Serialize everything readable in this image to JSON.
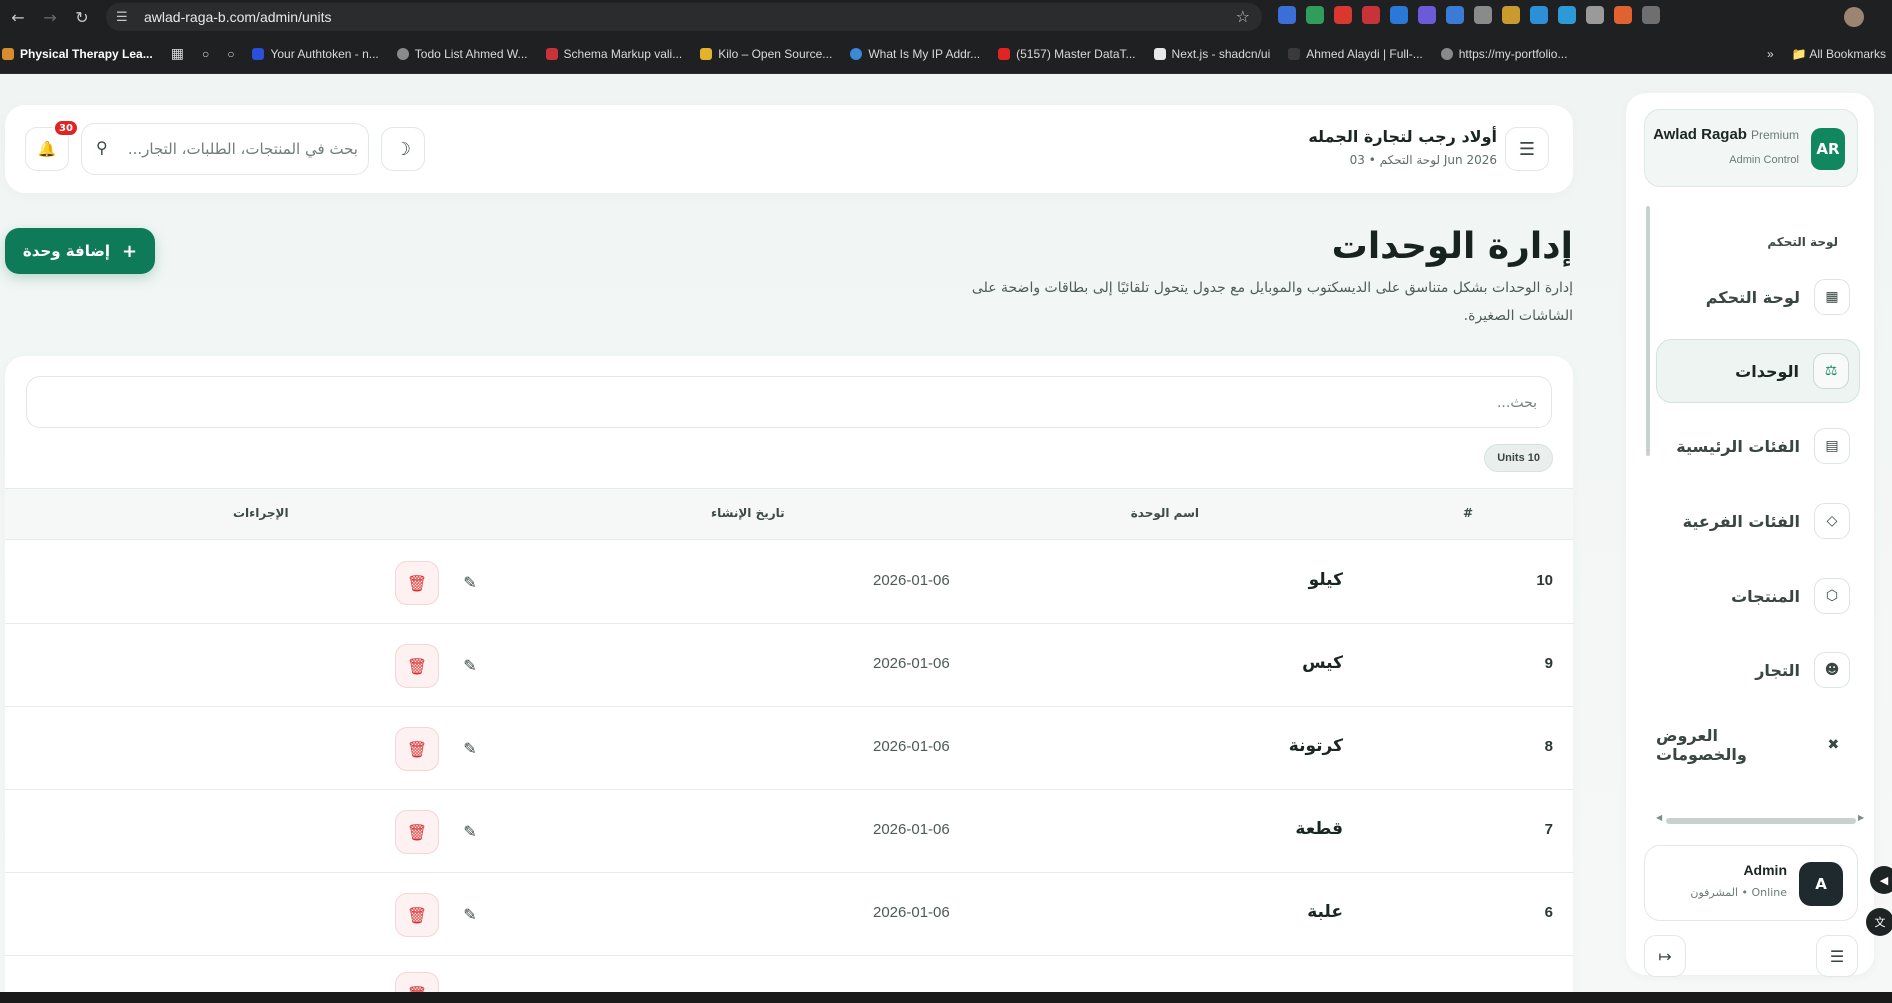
{
  "browser": {
    "url": "awlad-raga-b.com/admin/units",
    "bookmarks": [
      "Physical Therapy Lea...",
      "Your Authtoken - n...",
      "Todo List Ahmed W...",
      "Schema Markup vali...",
      "Kilo – Open Source...",
      "What Is My IP Addr...",
      "(5157) Master DataT...",
      "Next.js - shadcn/ui",
      "Ahmed Alaydi | Full-...",
      "https://my-portfolio..."
    ],
    "all_bookmarks": "All Bookmarks",
    "more": "»"
  },
  "sidebar": {
    "brand_name": "Awlad Ragab",
    "brand_tag": "Premium",
    "brand_sub": "Admin Control",
    "brand_initials": "AR",
    "section_label": "لوحة التحكم",
    "items": [
      {
        "label": "لوحة التحكم",
        "icon": "grid-icon"
      },
      {
        "label": "الوحدات",
        "icon": "scale-icon",
        "active": true
      },
      {
        "label": "الفئات الرئيسية",
        "icon": "layers-icon"
      },
      {
        "label": "الفئات الفرعية",
        "icon": "tag-icon"
      },
      {
        "label": "المنتجات",
        "icon": "box-icon"
      },
      {
        "label": "التجار",
        "icon": "users-icon"
      },
      {
        "label": "العروض والخصومات",
        "icon": "discount-icon"
      }
    ],
    "admin_name": "Admin",
    "admin_initial": "A",
    "admin_sub": "المشرفون • Online"
  },
  "header": {
    "store_title": "أولاد رجب لتجارة الجمله",
    "store_sub": "لوحة التحكم • 03 Jun 2026",
    "search_placeholder": "بحث في المنتجات، الطلبات، التجار...",
    "notifications": "30"
  },
  "page": {
    "title": "إدارة الوحدات",
    "description": "إدارة الوحدات بشكل متناسق على الديسكتوب والموبايل مع جدول يتحول تلقائيًا إلى بطاقات واضحة على الشاشات الصغيرة.",
    "add_button": "إضافة وحدة"
  },
  "table": {
    "search_placeholder": "بحث...",
    "count_label": "Units 10",
    "columns": {
      "num": "#",
      "name": "اسم الوحدة",
      "date": "تاريخ الإنشاء",
      "actions": "الإجراءات"
    },
    "rows": [
      {
        "num": "10",
        "name": "كيلو",
        "date": "2026-01-06"
      },
      {
        "num": "9",
        "name": "كيس",
        "date": "2026-01-06"
      },
      {
        "num": "8",
        "name": "كرتونة",
        "date": "2026-01-06"
      },
      {
        "num": "7",
        "name": "قطعة",
        "date": "2026-01-06"
      },
      {
        "num": "6",
        "name": "علبة",
        "date": "2026-01-06"
      }
    ]
  },
  "colors": {
    "brand": "#0f7a57",
    "danger": "#d92d2d",
    "badge": "#e02424"
  }
}
